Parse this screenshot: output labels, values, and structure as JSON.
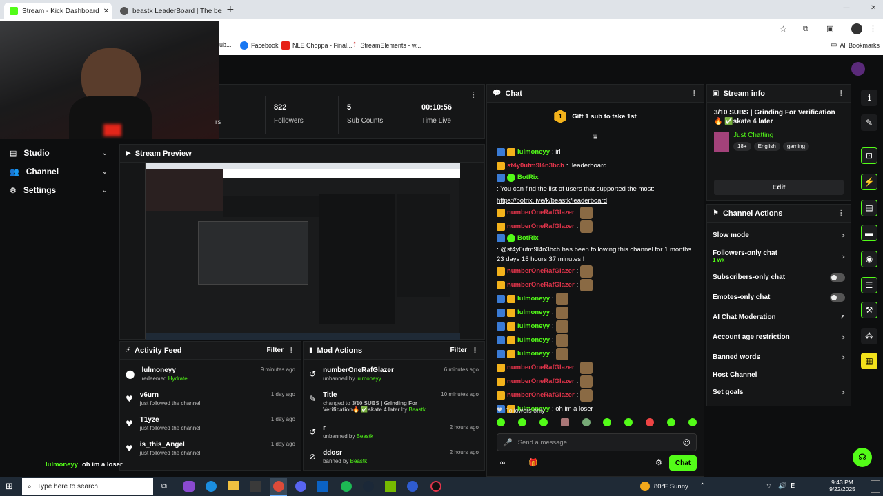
{
  "browser": {
    "tabs": [
      {
        "title": "Stream - Kick Dashboard",
        "favicon_color": "#53fc18"
      },
      {
        "title": "beastk LeaderBoard | The best",
        "favicon_color": "#555"
      }
    ],
    "bookmarks": [
      {
        "label": "ub...",
        "icon": "ub-icon"
      },
      {
        "label": "Facebook",
        "icon": "facebook-icon"
      },
      {
        "label": "NLE Choppa - Final...",
        "icon": "youtube-icon"
      },
      {
        "label": "StreamElements - w...",
        "icon": "streamelements-icon"
      }
    ],
    "all_bookmarks": "All Bookmarks"
  },
  "stats": [
    {
      "label": "rs",
      "value": ""
    },
    {
      "label": "Followers",
      "value": "822"
    },
    {
      "label": "Sub Counts",
      "value": "5"
    },
    {
      "label": "Time Live",
      "value": "00:10:56"
    }
  ],
  "nav": [
    {
      "label": "Studio",
      "icon": "studio-icon"
    },
    {
      "label": "Channel",
      "icon": "channel-icon"
    },
    {
      "label": "Settings",
      "icon": "gear-icon"
    }
  ],
  "stream_preview": {
    "title": "Stream Preview"
  },
  "activity_feed": {
    "title": "Activity Feed",
    "filter": "Filter",
    "items": [
      {
        "user": "lulmoneyy",
        "action": "redeemed ",
        "highlight": "Hydrate",
        "time": "9 minutes ago"
      },
      {
        "user": "v6urn",
        "action": "just followed the channel",
        "highlight": "",
        "time": "1 day ago"
      },
      {
        "user": "T1yze",
        "action": "just followed the channel",
        "highlight": "",
        "time": "1 day ago"
      },
      {
        "user": "is_this_Angel",
        "action": "just followed the channel",
        "highlight": "",
        "time": "1 day ago"
      }
    ]
  },
  "mod_actions": {
    "title": "Mod Actions",
    "filter": "Filter",
    "items": [
      {
        "title": "numberOneRafGlazer",
        "line": "unbanned by ",
        "by": "lulmoneyy",
        "time": "6 minutes ago"
      },
      {
        "title": "Title",
        "line": "changed to ",
        "extra": "3/10 SUBS | Grinding For Verification🔥 ✅skate 4 later",
        "by": "Beastk",
        "time": "10 minutes ago"
      },
      {
        "title": "r",
        "line": "unbanned by ",
        "by": "Beastk",
        "time": "2 hours ago"
      },
      {
        "title": "ddosr",
        "line": "banned by ",
        "by": "Beastk",
        "time": "2 hours ago"
      }
    ]
  },
  "overlay_chat": {
    "user": "lulmoneyy",
    "message": "oh im a loser"
  },
  "chat": {
    "title": "Chat",
    "gift_banner": "Gift 1 sub to take 1st",
    "gift_count": "1",
    "messages": [
      {
        "user": "lulmoneyy",
        "color": "#53fc18",
        "text": ": irl",
        "emotes": 0
      },
      {
        "user": "st4y0utm9l4n3bch",
        "color": "#e0344a",
        "text": ": !leaderboard",
        "emotes": 0
      },
      {
        "user": "BotRix",
        "color": "#53fc18",
        "text": ": You can find the list of users that supported the most: ",
        "link": "https://botrix.live/k/beastk/leaderboard",
        "emotes": 0
      },
      {
        "user": "numberOneRafGlazer",
        "color": "#e0344a",
        "text": ":",
        "emotes": 1
      },
      {
        "user": "numberOneRafGlazer",
        "color": "#e0344a",
        "text": ":",
        "emotes": 1
      },
      {
        "user": "BotRix",
        "color": "#53fc18",
        "text": ": @st4y0utm9l4n3bch has been following this channel for 1 months 23 days 15 hours 37 minutes !",
        "emotes": 0
      },
      {
        "user": "numberOneRafGlazer",
        "color": "#e0344a",
        "text": ":",
        "emotes": 1
      },
      {
        "user": "numberOneRafGlazer",
        "color": "#e0344a",
        "text": ":",
        "emotes": 1
      },
      {
        "user": "lulmoneyy",
        "color": "#53fc18",
        "text": ":",
        "emotes": 1
      },
      {
        "user": "lulmoneyy",
        "color": "#53fc18",
        "text": ":",
        "emotes": 1
      },
      {
        "user": "lulmoneyy",
        "color": "#53fc18",
        "text": ":",
        "emotes": 1
      },
      {
        "user": "lulmoneyy",
        "color": "#53fc18",
        "text": ":",
        "emotes": 1
      },
      {
        "user": "lulmoneyy",
        "color": "#53fc18",
        "text": ":",
        "emotes": 1
      },
      {
        "user": "numberOneRafGlazer",
        "color": "#e0344a",
        "text": ":",
        "emotes": 1
      },
      {
        "user": "numberOneRafGlazer",
        "color": "#e0344a",
        "text": ":",
        "emotes": 1
      },
      {
        "user": "numberOneRafGlazer",
        "color": "#e0344a",
        "text": ":",
        "emotes": 1
      },
      {
        "user": "lulmoneyy",
        "color": "#53fc18",
        "text": ": oh im a loser",
        "emotes": 0
      }
    ],
    "followers_only": "Followers only",
    "input_placeholder": "Send a message",
    "send_label": "Chat"
  },
  "stream_info": {
    "title": "Stream info",
    "stream_title": "3/10 SUBS | Grinding For Verification🔥 ✅skate 4 later",
    "category": "Just Chatting",
    "tags": [
      "18+",
      "English",
      "gaming"
    ],
    "edit_label": "Edit"
  },
  "channel_actions": {
    "title": "Channel Actions",
    "items": [
      {
        "label": "Slow mode",
        "sub": "",
        "control": "chevron"
      },
      {
        "label": "Followers-only chat",
        "sub": "1 wk",
        "control": "chevron"
      },
      {
        "label": "Subscribers-only chat",
        "sub": "",
        "control": "toggle"
      },
      {
        "label": "Emotes-only chat",
        "sub": "",
        "control": "toggle"
      },
      {
        "label": "AI Chat Moderation",
        "sub": "",
        "control": "external"
      },
      {
        "label": "Account age restriction",
        "sub": "",
        "control": "chevron"
      },
      {
        "label": "Banned words",
        "sub": "",
        "control": "chevron"
      },
      {
        "label": "Host Channel",
        "sub": "",
        "control": "none"
      },
      {
        "label": "Set goals",
        "sub": "",
        "control": "chevron"
      }
    ]
  },
  "taskbar": {
    "search_placeholder": "Type here to search",
    "weather": "80°F  Sunny",
    "time": "9:43 PM",
    "date": "9/22/2025"
  },
  "colors": {
    "accent": "#53fc18",
    "danger": "#e0344a",
    "panel": "#151617"
  }
}
